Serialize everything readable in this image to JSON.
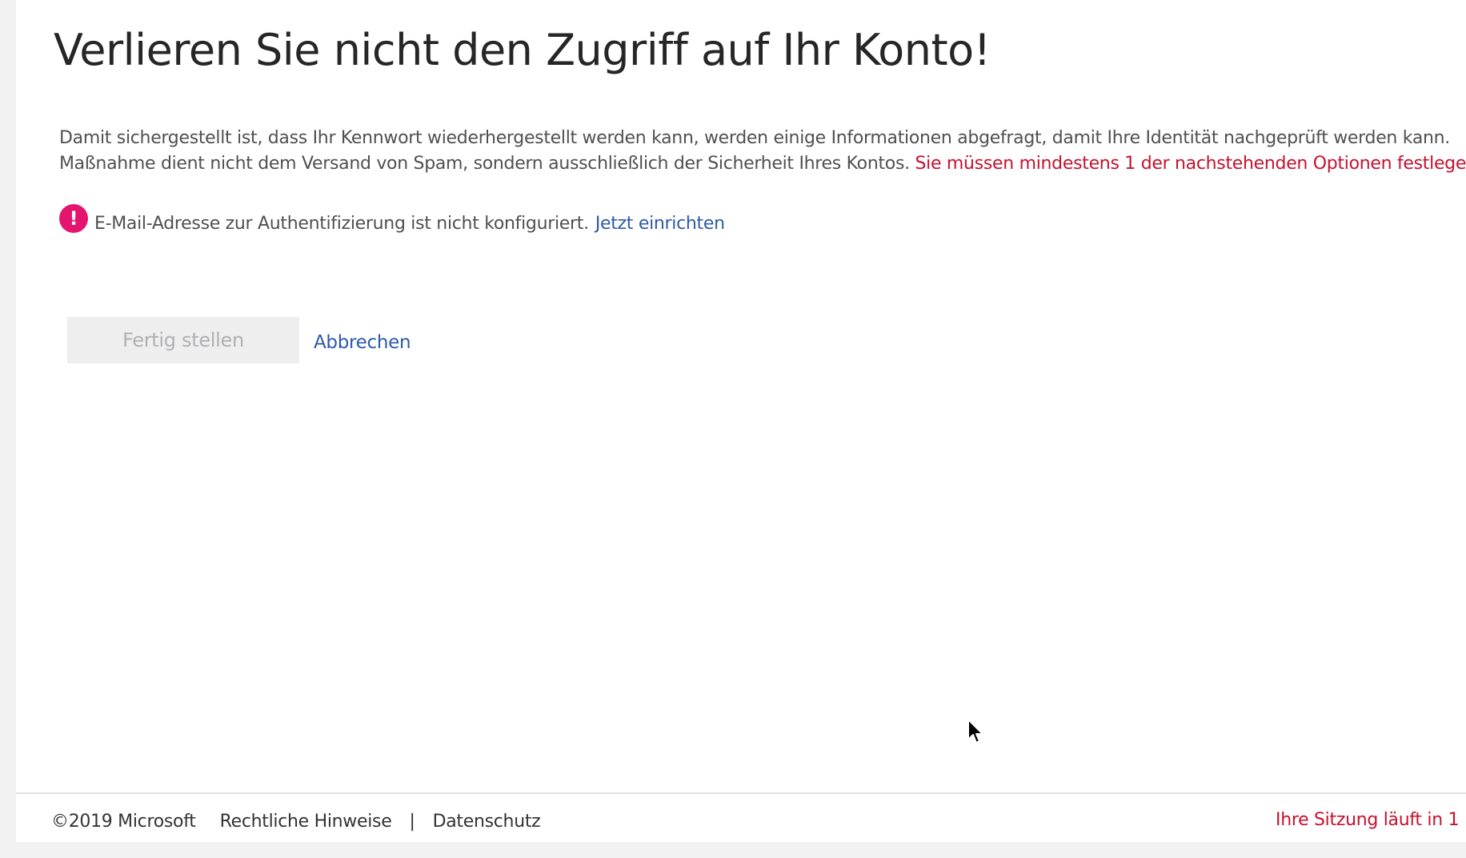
{
  "page": {
    "title": "Verlieren Sie nicht den Zugriff auf Ihr Konto!",
    "intro_line1": "Damit sichergestellt ist, dass Ihr Kennwort wiederhergestellt werden kann, werden einige Informationen abgefragt, damit Ihre Identität nachgeprüft werden kann.",
    "intro_line2": "Maßnahme dient nicht dem Versand von Spam, sondern ausschließlich der Sicherheit Ihres Kontos.",
    "intro_required": "Sie müssen mindestens 1 der nachstehenden Optionen festlege"
  },
  "notice": {
    "icon": "exclamation-circle-icon",
    "icon_glyph": "!",
    "text": "E-Mail-Adresse zur Authentifizierung ist nicht konfiguriert.",
    "link": "Jetzt einrichten"
  },
  "actions": {
    "finish_label": "Fertig stellen",
    "cancel_label": "Abbrechen"
  },
  "footer": {
    "copyright": "©2019 Microsoft",
    "legal": "Rechtliche Hinweise",
    "separator": "|",
    "privacy": "Datenschutz",
    "session": "Ihre Sitzung läuft in 1"
  },
  "colors": {
    "alert": "#e5156f",
    "link": "#2c5aa8",
    "error": "#c8102e"
  }
}
